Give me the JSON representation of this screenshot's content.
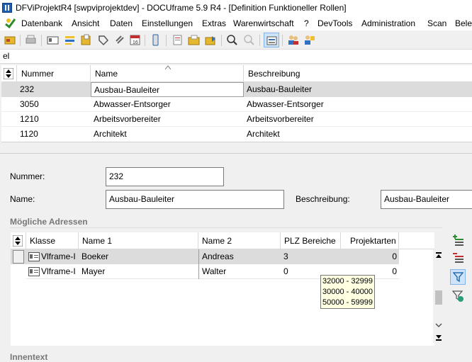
{
  "window": {
    "title": "DFViProjektR4 [swpviprojektdev] - DOCUframe 5.9 R4 - [Definition Funktioneller Rollen]"
  },
  "menu": [
    "Datenbank",
    "Ansicht",
    "Daten",
    "Einstellungen",
    "Extras",
    "Warenwirtschaft",
    "?",
    "DevTools",
    "Administration",
    "Scan",
    "Beleg"
  ],
  "search": {
    "value": "el"
  },
  "main_table": {
    "columns": [
      "Nummer",
      "Name",
      "Beschreibung"
    ],
    "rows": [
      {
        "nummer": "232",
        "name": "Ausbau-Bauleiter",
        "beschreibung": "Ausbau-Bauleiter"
      },
      {
        "nummer": "3050",
        "name": "Abwasser-Entsorger",
        "beschreibung": "Abwasser-Entsorger"
      },
      {
        "nummer": "1210",
        "name": "Arbeitsvorbereiter",
        "beschreibung": "Arbeitsvorbereiter"
      },
      {
        "nummer": "1120",
        "name": "Architekt",
        "beschreibung": "Architekt"
      }
    ]
  },
  "form": {
    "nummer_label": "Nummer:",
    "nummer_value": "232",
    "name_label": "Name:",
    "name_value": "Ausbau-Bauleiter",
    "beschreibung_label": "Beschreibung:",
    "beschreibung_value": "Ausbau-Bauleiter"
  },
  "addresses": {
    "section_title": "Mögliche Adressen",
    "columns": [
      "Klasse",
      "Name 1",
      "Name 2",
      "PLZ Bereiche",
      "Projektarten"
    ],
    "rows": [
      {
        "klasse": "Vlframe-I",
        "name1": "Boeker",
        "name2": "Andreas",
        "plz": "3",
        "projektarten": "0"
      },
      {
        "klasse": "Vlframe-I",
        "name1": "Mayer",
        "name2": "Walter",
        "plz": "0",
        "projektarten": "0"
      }
    ],
    "tooltip": [
      "32000 - 32999",
      "30000 - 40000",
      "50000 - 59999"
    ]
  },
  "bottom_label": "Innentext"
}
